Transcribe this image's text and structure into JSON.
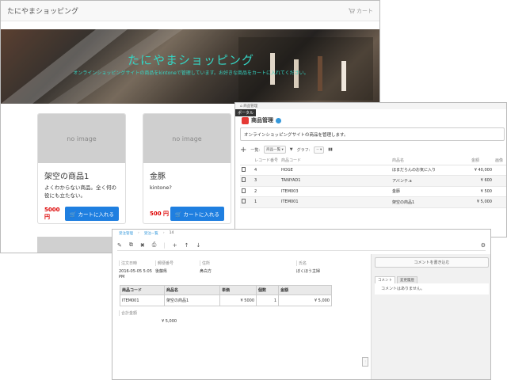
{
  "shop": {
    "brand": "たにやまショッピング",
    "cart_label": "カート",
    "hero_title": "たにやまショッピング",
    "hero_subtitle": "オンラインショッピングサイトの商品をkintoneで管理しています。お好きな商品をカートに入れてください。",
    "products": [
      {
        "image_text": "no image",
        "title": "架空の商品1",
        "desc": "よくわからない商品。全く何の役にも立たない。",
        "price": "5000 円",
        "button": "カートに入れる"
      },
      {
        "image_text": "no image",
        "title": "金豚",
        "desc": "kintone?",
        "price": "500 円",
        "button": "カートに入れる"
      }
    ]
  },
  "list_window": {
    "breadcrumb": "商品管理",
    "portal_tab": "ポータル",
    "app_name": "商品管理",
    "description": "オンラインショッピングサイトの商品を管理します。",
    "view_label": "一覧:",
    "view_value": "商品一覧",
    "graph_label": "グラフ:",
    "columns": [
      "レコード番号",
      "商品コード",
      "商品名",
      "金額",
      "画像"
    ],
    "rows": [
      {
        "no": "4",
        "code": "HOGE",
        "name": "ほまだらんのお気に入り",
        "price": "¥ 40,000"
      },
      {
        "no": "3",
        "code": "TANIYAD1",
        "name": "アバンテ.a",
        "price": "¥ 600"
      },
      {
        "no": "2",
        "code": "ITEM003",
        "name": "金豚",
        "price": "¥ 500"
      },
      {
        "no": "1",
        "code": "ITEM001",
        "name": "架空の商品1",
        "price": "¥ 5,000"
      }
    ]
  },
  "detail_window": {
    "breadcrumb": [
      "受注管理",
      "受注一覧",
      "14"
    ],
    "fields": [
      {
        "label": "注文日時",
        "value": "2016-05-05 5:05 PM"
      },
      {
        "label": "郵便番号",
        "value": "後藤県"
      },
      {
        "label": "住所",
        "value": "鼻白方"
      },
      {
        "label": "氏名",
        "value": "ぼくほう主婦"
      }
    ],
    "table_headers": [
      "商品コード",
      "商品名",
      "単価",
      "個数",
      "金額"
    ],
    "table_rows": [
      {
        "code": "ITEM001",
        "name": "架空の商品1",
        "unit": "¥ 5000",
        "qty": "1",
        "amount": "¥ 5,000"
      }
    ],
    "total_label": "合計金額",
    "total_value": "¥ 5,000",
    "comment_button": "コメントを書き込む",
    "tabs": [
      "コメント",
      "変更履歴"
    ],
    "no_comment": "コメントはありません。"
  }
}
